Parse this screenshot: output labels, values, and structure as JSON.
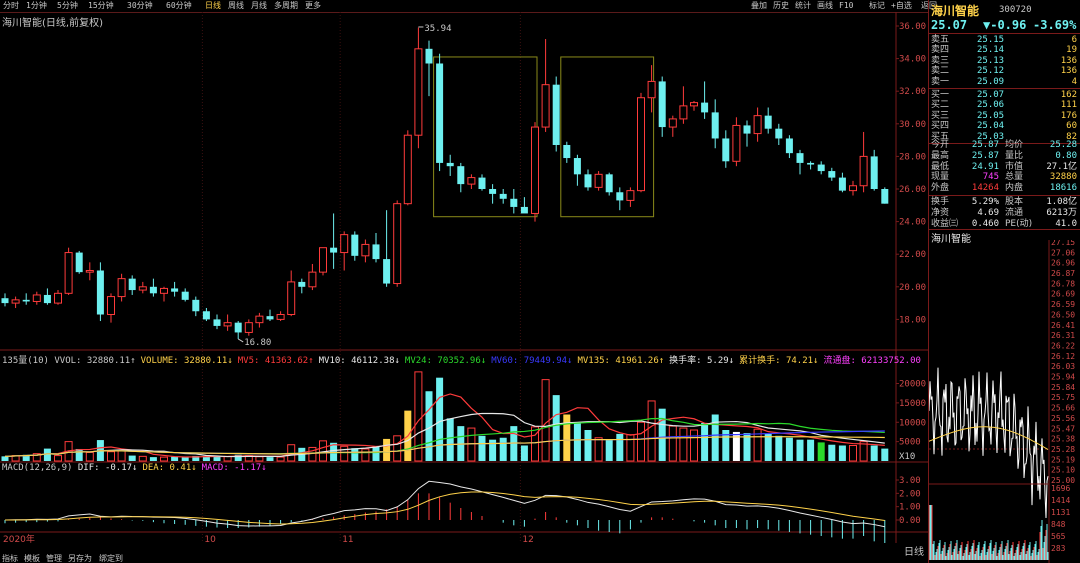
{
  "toolbar": {
    "periods": [
      "分时",
      "1分钟",
      "5分钟",
      "15分钟",
      "30分钟",
      "60分钟",
      "日线",
      "周线",
      "月线",
      "多周期",
      "更多"
    ],
    "active": "日线",
    "right": [
      "叠加",
      "历史",
      "统计",
      "画线",
      "F10",
      "标记",
      "+自选",
      "返回"
    ]
  },
  "stock": {
    "name": "海川智能",
    "code": "300720",
    "title": "海川智能(日线,前复权)"
  },
  "price_axis": [
    "36.00",
    "34.00",
    "32.00",
    "30.00",
    "28.00",
    "26.00",
    "24.00",
    "22.00",
    "20.00",
    "18.00"
  ],
  "annotations": {
    "high": "35.94",
    "low": "16.80"
  },
  "volume_header": {
    "label": "135量(10)",
    "items": [
      {
        "text": "VVOL: 32880.11↑",
        "color": "#c8c8c8"
      },
      {
        "text": "VOLUME: 32880.11↓",
        "color": "#ffd24a"
      },
      {
        "text": "MV5: 41363.62↑",
        "color": "#ff3b3b"
      },
      {
        "text": "MV10: 46112.38↓",
        "color": "#e8e8e8"
      },
      {
        "text": "MV24: 70352.96↓",
        "color": "#2bd92b"
      },
      {
        "text": "MV60: 79449.94↓",
        "color": "#3a3aff"
      },
      {
        "text": "MV135: 41961.26↑",
        "color": "#ffd24a"
      },
      {
        "text": "换手率: 5.29↓",
        "color": "#e8e8e8"
      },
      {
        "text": "累计换手: 74.21↓",
        "color": "#ffd24a"
      },
      {
        "text": "流通盘: 62133752.00",
        "color": "#ff40ff"
      }
    ]
  },
  "volume_axis": [
    "20000",
    "15000",
    "10000",
    "5000"
  ],
  "volume_unit": "X10",
  "macd_header": {
    "label": "MACD(12,26,9)",
    "items": [
      {
        "text": "DIF: -0.17↓",
        "color": "#e8e8e8"
      },
      {
        "text": "DEA: 0.41↓",
        "color": "#ffd24a"
      },
      {
        "text": "MACD: -1.17↓",
        "color": "#ff40ff"
      }
    ]
  },
  "macd_axis": [
    "3.00",
    "2.00",
    "1.00",
    "0.00"
  ],
  "date_axis": [
    {
      "t": "2020年",
      "i": 0
    },
    {
      "t": "10",
      "i": 19
    },
    {
      "t": "11",
      "i": 32
    },
    {
      "t": "12",
      "i": 49
    }
  ],
  "bottom_tabs": [
    "指标",
    "模板",
    "管理",
    "另存为",
    "绑定到"
  ],
  "bottom_right": "日线",
  "quote": {
    "price": "25.07",
    "change": "▼-0.96",
    "pct": "-3.69%"
  },
  "asks": [
    {
      "label": "卖五",
      "price": "25.15",
      "vol": "6"
    },
    {
      "label": "卖四",
      "price": "25.14",
      "vol": "19"
    },
    {
      "label": "卖三",
      "price": "25.13",
      "vol": "136"
    },
    {
      "label": "卖二",
      "price": "25.12",
      "vol": "136"
    },
    {
      "label": "卖一",
      "price": "25.09",
      "vol": "4"
    }
  ],
  "bids": [
    {
      "label": "买一",
      "price": "25.07",
      "vol": "162"
    },
    {
      "label": "买二",
      "price": "25.06",
      "vol": "111"
    },
    {
      "label": "买三",
      "price": "25.05",
      "vol": "176"
    },
    {
      "label": "买四",
      "price": "25.04",
      "vol": "60"
    },
    {
      "label": "买五",
      "price": "25.03",
      "vol": "82"
    }
  ],
  "stats": [
    {
      "k1": "今开",
      "v1": "25.87",
      "c1": "#6ef0f0",
      "k2": "均价",
      "v2": "25.28",
      "c2": "#6ef0f0"
    },
    {
      "k1": "最高",
      "v1": "25.87",
      "c1": "#6ef0f0",
      "k2": "量比",
      "v2": "0.80",
      "c2": "#6ef0f0"
    },
    {
      "k1": "最低",
      "v1": "24.91",
      "c1": "#6ef0f0",
      "k2": "市值",
      "v2": "27.1亿",
      "c2": "#e8e8e8"
    },
    {
      "k1": "现量",
      "v1": "745",
      "c1": "#ff40ff",
      "k2": "总量",
      "v2": "32880",
      "c2": "#ffd24a"
    },
    {
      "k1": "外盘",
      "v1": "14264",
      "c1": "#ff3b3b",
      "k2": "内盘",
      "v2": "18616",
      "c2": "#6ef0f0"
    },
    {
      "k1": "换手",
      "v1": "5.29%",
      "c1": "#e8e8e8",
      "k2": "股本",
      "v2": "1.08亿",
      "c2": "#e8e8e8"
    },
    {
      "k1": "净资",
      "v1": "4.69",
      "c1": "#e8e8e8",
      "k2": "流通",
      "v2": "6213万",
      "c2": "#e8e8e8"
    },
    {
      "k1": "收益㈢",
      "v1": "0.460",
      "c1": "#e8e8e8",
      "k2": "PE(动)",
      "v2": "41.0",
      "c2": "#e8e8e8"
    }
  ],
  "intraday_title": "海川智能",
  "intraday_axis": [
    "27.15",
    "27.06",
    "26.96",
    "26.87",
    "26.78",
    "26.69",
    "26.59",
    "26.50",
    "26.41",
    "26.31",
    "26.22",
    "26.12",
    "26.03",
    "25.94",
    "25.84",
    "25.75",
    "25.66",
    "25.56",
    "25.47",
    "25.38",
    "25.28",
    "25.19",
    "25.10",
    "25.00"
  ],
  "intraday_vol_axis": [
    "1696",
    "1414",
    "1131",
    "848",
    "565",
    "283"
  ],
  "colors": {
    "up": "#ff3b3b",
    "down": "#6ef0f0",
    "frame": "#7a1a1a",
    "box": "#8a8a1a"
  },
  "chart_data": {
    "type": "candlestick",
    "ylim": [
      16,
      36
    ],
    "candles": [
      [
        19.3,
        19.6,
        18.8,
        19.0
      ],
      [
        19.0,
        19.4,
        18.7,
        19.2
      ],
      [
        19.2,
        19.6,
        18.9,
        19.1
      ],
      [
        19.1,
        19.7,
        18.9,
        19.5
      ],
      [
        19.5,
        19.9,
        18.9,
        19.0
      ],
      [
        19.0,
        19.8,
        18.9,
        19.6
      ],
      [
        19.6,
        22.4,
        19.5,
        22.1
      ],
      [
        22.1,
        22.2,
        20.8,
        20.9
      ],
      [
        20.9,
        21.5,
        20.4,
        21.0
      ],
      [
        21.0,
        21.5,
        17.9,
        18.3
      ],
      [
        18.3,
        19.6,
        17.8,
        19.4
      ],
      [
        19.4,
        20.8,
        19.1,
        20.5
      ],
      [
        20.5,
        20.7,
        19.5,
        19.8
      ],
      [
        19.8,
        20.3,
        19.6,
        20.0
      ],
      [
        20.0,
        20.5,
        19.4,
        19.6
      ],
      [
        19.6,
        20.0,
        19.1,
        19.9
      ],
      [
        19.9,
        20.3,
        19.4,
        19.7
      ],
      [
        19.7,
        19.9,
        19.1,
        19.2
      ],
      [
        19.2,
        19.4,
        18.2,
        18.5
      ],
      [
        18.5,
        18.7,
        17.9,
        18.0
      ],
      [
        18.0,
        18.3,
        17.4,
        17.6
      ],
      [
        17.6,
        18.3,
        17.3,
        17.8
      ],
      [
        17.8,
        17.9,
        16.8,
        17.2
      ],
      [
        17.2,
        18.0,
        17.0,
        17.8
      ],
      [
        17.8,
        18.4,
        17.5,
        18.2
      ],
      [
        18.2,
        18.6,
        17.9,
        18.0
      ],
      [
        18.0,
        18.5,
        17.9,
        18.3
      ],
      [
        18.3,
        21.0,
        18.2,
        20.3
      ],
      [
        20.3,
        20.5,
        19.6,
        20.0
      ],
      [
        20.0,
        21.4,
        19.8,
        20.9
      ],
      [
        20.9,
        21.6,
        20.7,
        22.4
      ],
      [
        22.4,
        24.5,
        21.1,
        22.1
      ],
      [
        22.1,
        23.4,
        21.0,
        23.2
      ],
      [
        23.2,
        23.4,
        21.6,
        21.9
      ],
      [
        21.9,
        22.9,
        21.5,
        22.6
      ],
      [
        22.6,
        23.3,
        21.5,
        21.7
      ],
      [
        21.7,
        24.7,
        20.0,
        20.2
      ],
      [
        20.2,
        25.3,
        20.0,
        25.1
      ],
      [
        25.1,
        29.6,
        25.0,
        29.3
      ],
      [
        29.3,
        35.9,
        28.5,
        34.6
      ],
      [
        34.6,
        35.1,
        31.7,
        33.7
      ],
      [
        33.7,
        34.3,
        27.1,
        27.6
      ],
      [
        27.6,
        28.1,
        26.8,
        27.4
      ],
      [
        27.4,
        27.6,
        25.8,
        26.3
      ],
      [
        26.3,
        26.9,
        26.0,
        26.7
      ],
      [
        26.7,
        26.9,
        25.9,
        26.0
      ],
      [
        26.0,
        26.3,
        25.1,
        25.7
      ],
      [
        25.7,
        26.0,
        25.1,
        25.4
      ],
      [
        25.4,
        26.0,
        24.5,
        24.9
      ],
      [
        24.9,
        25.5,
        24.6,
        24.5
      ],
      [
        24.5,
        30.1,
        24.0,
        29.8
      ],
      [
        29.8,
        35.2,
        29.5,
        32.4
      ],
      [
        32.4,
        32.9,
        28.3,
        28.7
      ],
      [
        28.7,
        28.9,
        27.6,
        27.9
      ],
      [
        27.9,
        28.1,
        26.2,
        26.9
      ],
      [
        26.9,
        27.2,
        25.9,
        26.1
      ],
      [
        26.1,
        27.1,
        25.9,
        26.9
      ],
      [
        26.9,
        27.0,
        25.6,
        25.8
      ],
      [
        25.8,
        26.1,
        24.7,
        25.3
      ],
      [
        25.3,
        26.1,
        24.9,
        25.9
      ],
      [
        25.9,
        31.9,
        25.8,
        31.6
      ],
      [
        31.6,
        33.6,
        30.7,
        32.6
      ],
      [
        32.6,
        32.9,
        29.2,
        29.8
      ],
      [
        29.8,
        30.5,
        29.2,
        30.3
      ],
      [
        30.3,
        32.3,
        30.0,
        31.1
      ],
      [
        31.1,
        31.4,
        30.8,
        31.3
      ],
      [
        31.3,
        32.6,
        30.3,
        30.7
      ],
      [
        30.7,
        31.5,
        28.5,
        29.1
      ],
      [
        29.1,
        29.6,
        27.3,
        27.7
      ],
      [
        27.7,
        30.4,
        27.4,
        29.9
      ],
      [
        29.9,
        30.2,
        28.6,
        29.4
      ],
      [
        29.4,
        31.0,
        28.9,
        30.5
      ],
      [
        30.5,
        31.0,
        29.4,
        29.7
      ],
      [
        29.7,
        30.0,
        28.7,
        29.1
      ],
      [
        29.1,
        29.3,
        27.9,
        28.2
      ],
      [
        28.2,
        28.4,
        26.9,
        27.6
      ],
      [
        27.6,
        27.7,
        27.2,
        27.5
      ],
      [
        27.5,
        27.7,
        26.9,
        27.1
      ],
      [
        27.1,
        27.3,
        26.5,
        26.7
      ],
      [
        26.7,
        27.0,
        25.8,
        25.9
      ],
      [
        25.9,
        26.5,
        25.6,
        26.2
      ],
      [
        26.2,
        29.5,
        25.8,
        28.0
      ],
      [
        28.0,
        28.4,
        25.9,
        26.0
      ],
      [
        26.0,
        26.1,
        25.1,
        25.1
      ]
    ],
    "volume": [
      1200,
      1400,
      1600,
      1900,
      3200,
      1400,
      5000,
      3100,
      2200,
      5400,
      2400,
      2600,
      1400,
      1200,
      1000,
      1000,
      1100,
      900,
      1300,
      1300,
      1100,
      1200,
      1600,
      1400,
      1100,
      1000,
      1000,
      4200,
      3400,
      3500,
      5200,
      4700,
      3800,
      3300,
      3100,
      3800,
      5700,
      6500,
      13000,
      23000,
      18000,
      21500,
      11000,
      9000,
      8500,
      6500,
      5500,
      6000,
      9000,
      4000,
      8800,
      21000,
      17000,
      12000,
      10000,
      8000,
      6000,
      5500,
      7000,
      6800,
      10000,
      15500,
      13500,
      9000,
      8500,
      8000,
      9800,
      12000,
      8000,
      7500,
      7200,
      8200,
      7000,
      6500,
      6000,
      5500,
      5500,
      4800,
      4200,
      4000,
      4000,
      5000,
      4000,
      3200
    ],
    "macd_hist": [
      -0.12,
      -0.1,
      -0.08,
      -0.08,
      -0.06,
      -0.05,
      0.02,
      0.05,
      0.08,
      0.1,
      0.06,
      0.03,
      -0.02,
      -0.03,
      -0.08,
      -0.12,
      -0.15,
      -0.18,
      -0.22,
      -0.25,
      -0.28,
      -0.3,
      -0.3,
      -0.28,
      -0.25,
      -0.22,
      -0.15,
      -0.08,
      -0.02,
      0.02,
      0.06,
      0.12,
      0.18,
      0.22,
      0.28,
      0.32,
      0.4,
      0.5,
      0.75,
      1.0,
      1.0,
      0.85,
      0.65,
      0.45,
      0.3,
      0.15,
      0.0,
      -0.1,
      -0.2,
      -0.25,
      0.05,
      0.3,
      0.1,
      -0.1,
      -0.2,
      -0.3,
      -0.4,
      -0.45,
      -0.5,
      -0.35,
      -0.1,
      0.1,
      0.1,
      0.05,
      0.0,
      -0.05,
      -0.1,
      -0.2,
      -0.3,
      -0.3,
      -0.35,
      -0.3,
      -0.35,
      -0.4,
      -0.45,
      -0.5,
      -0.55,
      -0.6,
      -0.65,
      -0.7,
      -0.7,
      -0.6,
      -0.8,
      -1.17
    ]
  }
}
